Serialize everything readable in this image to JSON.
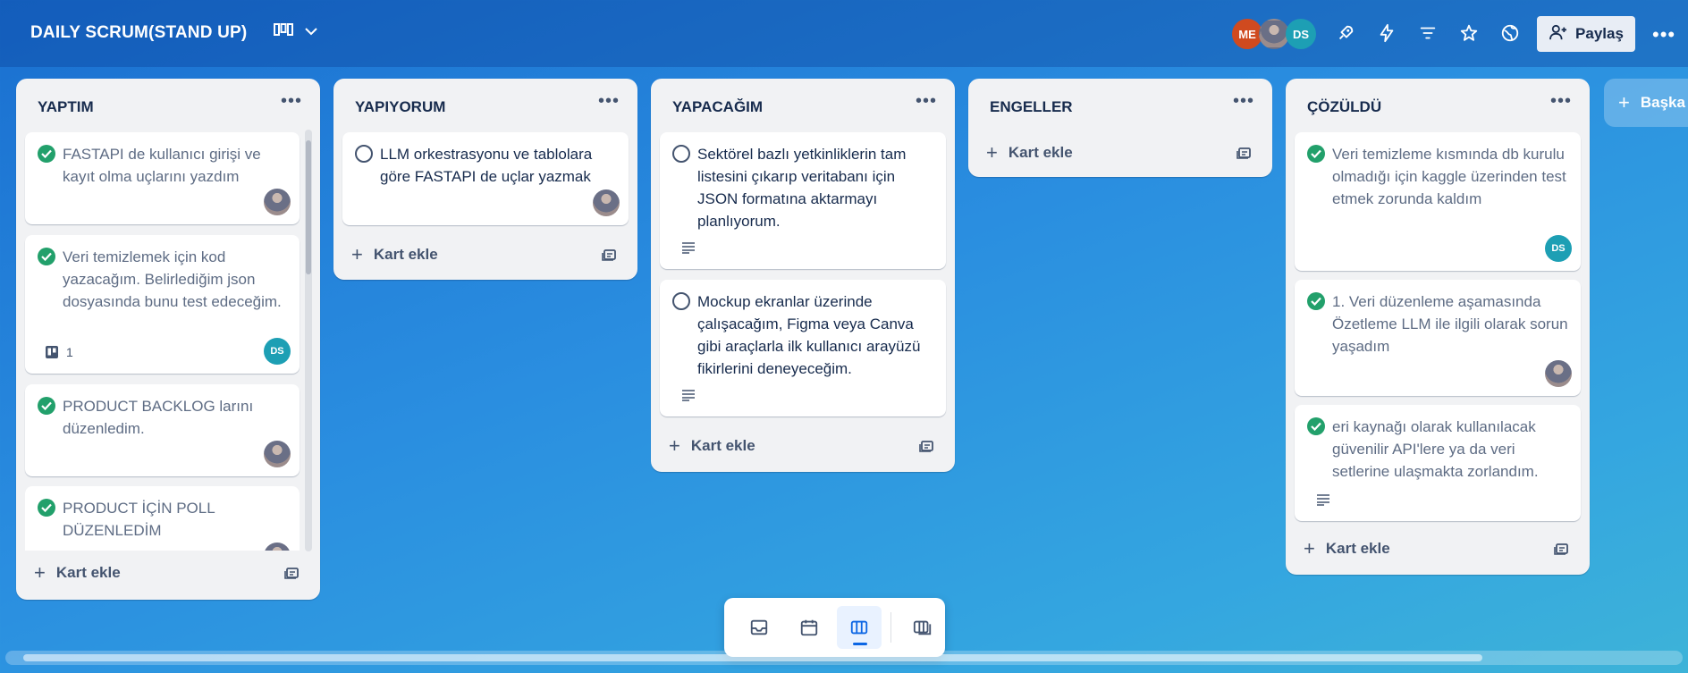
{
  "board": {
    "title": "DAILY SCRUM(STAND UP)",
    "members": [
      {
        "initials": "ME",
        "color": "#d04a1f"
      },
      {
        "initials": "",
        "color": "photo"
      },
      {
        "initials": "DS",
        "color": "#1d9fb4"
      }
    ],
    "share_label": "Paylaş",
    "add_list_label": "Başka"
  },
  "lists": [
    {
      "title": "YAPTIM",
      "add_label": "Kart ekle",
      "cards": [
        {
          "text": "FASTAPI de kullanıcı girişi ve kayıt olma uçlarını yazdım",
          "done": true,
          "member": "photo"
        },
        {
          "text": "Veri temizlemek için kod yazacağım. Belirlediğim json dosyasında bunu test edeceğim.",
          "done": true,
          "member": "DS",
          "checklist": "1"
        },
        {
          "text": "PRODUCT BACKLOG larını düzenledim.",
          "done": true,
          "member": "photo"
        },
        {
          "text": "PRODUCT İÇİN POLL DÜZENLEDİM",
          "done": true,
          "member": "photo"
        }
      ]
    },
    {
      "title": "YAPIYORUM",
      "add_label": "Kart ekle",
      "cards": [
        {
          "text": "LLM orkestrasyonu ve tablolara göre FASTAPI de uçlar yazmak",
          "done": false,
          "member": "photo"
        }
      ]
    },
    {
      "title": "YAPACAĞIM",
      "add_label": "Kart ekle",
      "cards": [
        {
          "text": "Sektörel bazlı yetkinliklerin tam listesini çıkarıp veritabanı için JSON formatına aktarmayı planlıyorum.",
          "done": false,
          "description": true
        },
        {
          "text": "Mockup ekranlar üzerinde çalışacağım, Figma veya Canva gibi araçlarla ilk kullanıcı arayüzü fikirlerini deneyeceğim.",
          "done": false,
          "description": true
        }
      ]
    },
    {
      "title": "ENGELLER",
      "add_label": "Kart ekle",
      "cards": []
    },
    {
      "title": "ÇÖZÜLDÜ",
      "add_label": "Kart ekle",
      "cards": [
        {
          "text": "Veri temizleme kısmında db kurulu olmadığı için kaggle üzerinden test etmek zorunda kaldım",
          "done": true,
          "member": "DS"
        },
        {
          "text": "1. Veri düzenleme aşamasında Özetleme LLM ile ilgili olarak sorun yaşadım",
          "done": true,
          "member": "photo"
        },
        {
          "text": "eri kaynağı olarak kullanılacak güvenilir API'lere ya da veri setlerine ulaşmakta zorlandım.",
          "done": true,
          "description": true
        }
      ]
    }
  ],
  "toolbar": {
    "views": [
      "inbox-icon",
      "calendar-icon",
      "board-icon",
      "switch-boards-icon"
    ],
    "active": "board-icon"
  },
  "colors": {
    "done_green": "#22a06b",
    "accent": "#0c66e4"
  }
}
